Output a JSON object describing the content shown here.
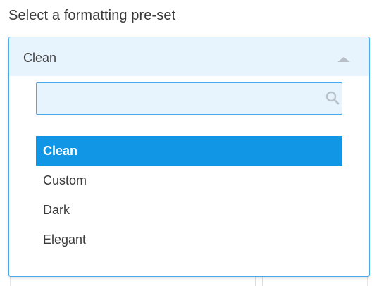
{
  "label": "Select a formatting pre-set",
  "dropdown": {
    "selected_value": "Clean",
    "search": {
      "value": "",
      "placeholder": ""
    },
    "options": [
      {
        "label": "Clean",
        "selected": true
      },
      {
        "label": "Custom",
        "selected": false
      },
      {
        "label": "Dark",
        "selected": false
      },
      {
        "label": "Elegant",
        "selected": false
      }
    ]
  },
  "icons": {
    "search": "search-icon",
    "caret": "chevron-up-icon"
  },
  "colors": {
    "accent": "#1196e6",
    "border": "#4aa9e9",
    "field_bg": "#e8f4fd",
    "text": "#3a3a3a",
    "caret": "#b8bfc6"
  }
}
